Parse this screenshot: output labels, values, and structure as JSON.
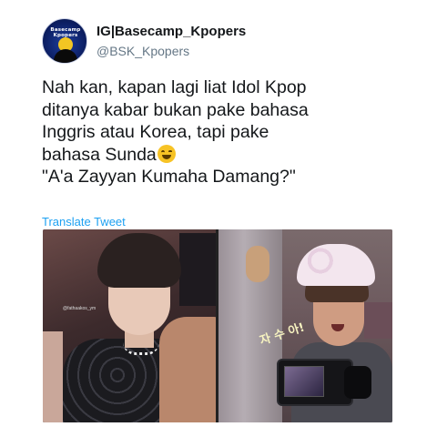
{
  "tweet": {
    "account": {
      "display_name": "IG|Basecamp_Kpopers",
      "handle": "@BSK_Kpopers",
      "avatar_text": "Basecamp Kpopers"
    },
    "lines": [
      "Nah kan, kapan lagi liat Idol Kpop",
      "ditanya kabar bukan pake bahasa",
      "Inggris atau Korea, tapi pake",
      "bahasa Sunda",
      "\"A'a Zayyan Kumaha Damang?\""
    ],
    "emoji_icon": "laughing-face-emoji",
    "translate_label": "Translate Tweet",
    "media": {
      "left_photo_watermark": "@fathaakos_ym",
      "right_photo_caption": "자 수 아!"
    }
  },
  "colors": {
    "link": "#1da1f2",
    "text": "#14171a",
    "secondary": "#657786",
    "background": "#ffffff"
  }
}
